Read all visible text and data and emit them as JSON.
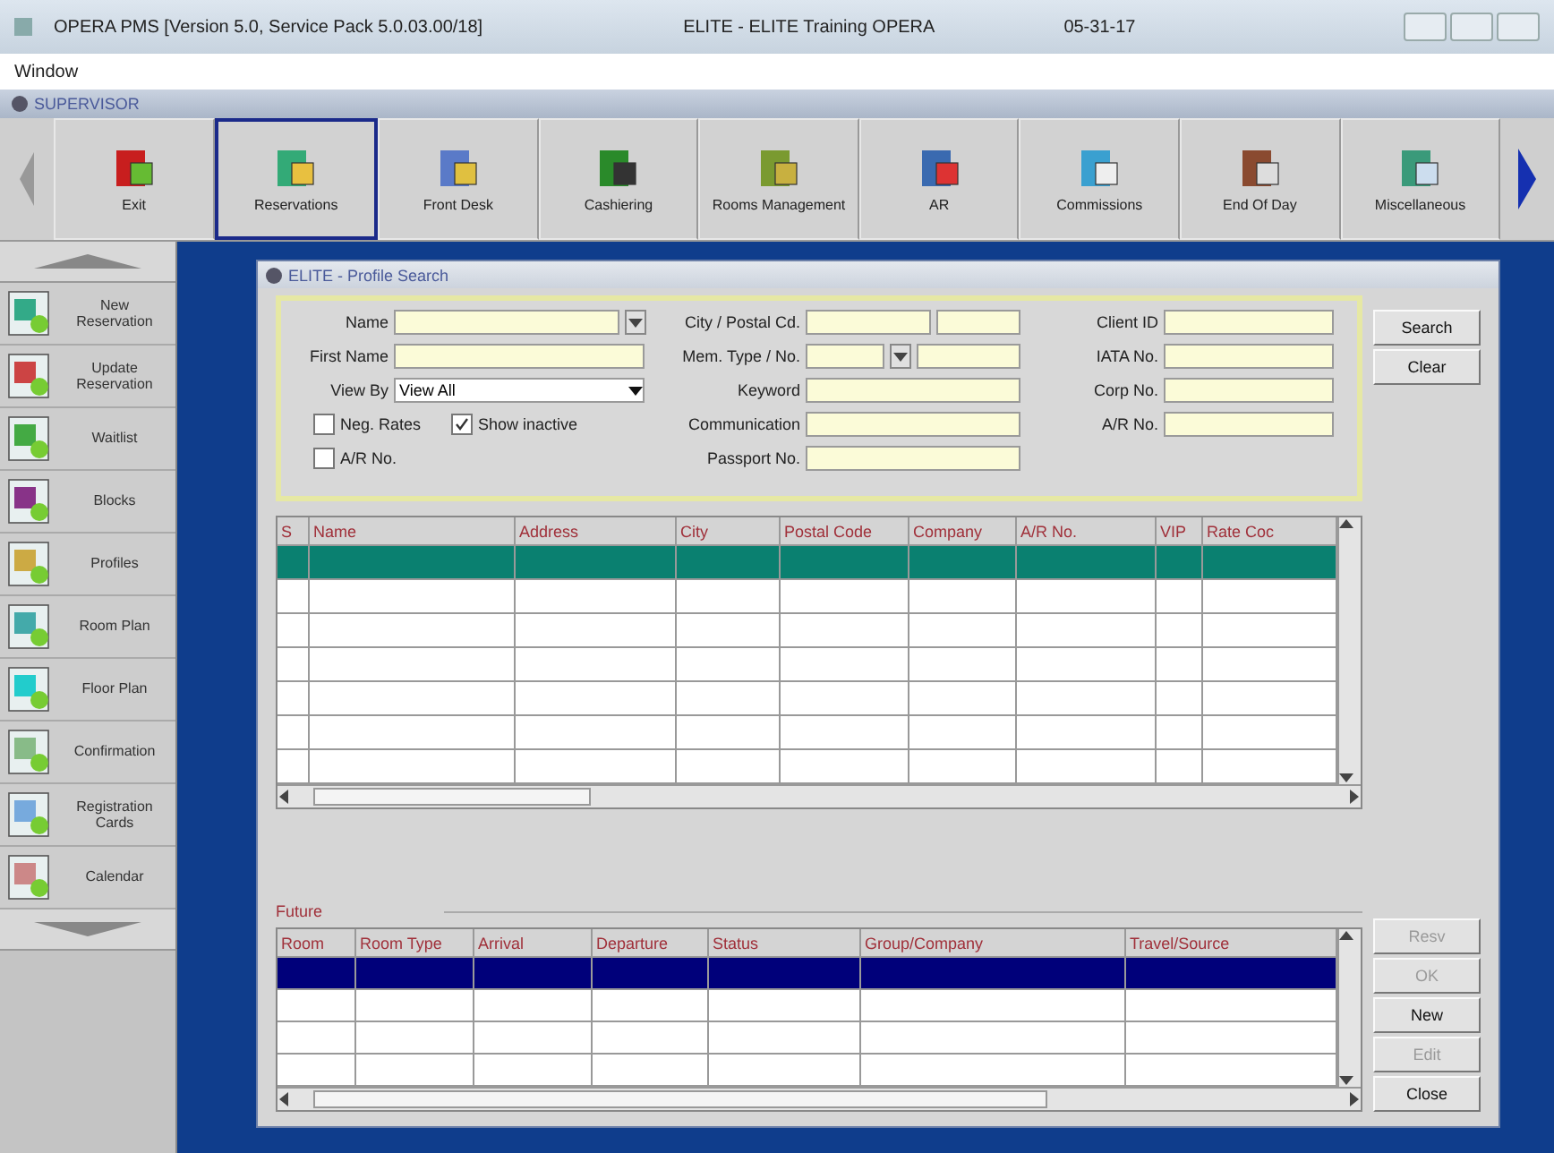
{
  "window": {
    "title": "OPERA PMS [Version 5.0, Service Pack 5.0.03.00/18]",
    "property": "ELITE - ELITE Training OPERA",
    "date": "05-31-17"
  },
  "menu": [
    "Window"
  ],
  "module": "SUPERVISOR",
  "toolbar": [
    {
      "label": "Exit",
      "selected": false
    },
    {
      "label": "Reservations",
      "selected": true
    },
    {
      "label": "Front Desk",
      "selected": false
    },
    {
      "label": "Cashiering",
      "selected": false
    },
    {
      "label": "Rooms Management",
      "selected": false
    },
    {
      "label": "AR",
      "selected": false
    },
    {
      "label": "Commissions",
      "selected": false
    },
    {
      "label": "End Of Day",
      "selected": false
    },
    {
      "label": "Miscellaneous",
      "selected": false
    }
  ],
  "sidebar": [
    {
      "label": "New Reservation"
    },
    {
      "label": "Update Reservation"
    },
    {
      "label": "Waitlist"
    },
    {
      "label": "Blocks"
    },
    {
      "label": "Profiles"
    },
    {
      "label": "Room Plan"
    },
    {
      "label": "Floor Plan"
    },
    {
      "label": "Confirmation"
    },
    {
      "label": "Registration Cards"
    },
    {
      "label": "Calendar"
    }
  ],
  "dialog": {
    "title": "ELITE - Profile Search",
    "form": [
      {
        "left": [
          {
            "kind": "lookup",
            "label": "Name"
          }
        ],
        "middle": [
          {
            "kind": "split",
            "label": "City / Postal Cd."
          }
        ],
        "right": [
          {
            "kind": "text",
            "label": "Client ID"
          }
        ]
      },
      {
        "left": [
          {
            "kind": "text",
            "label": "First Name"
          }
        ],
        "middle": [
          {
            "kind": "dropsplit",
            "label": "Mem. Type / No."
          }
        ],
        "right": [
          {
            "kind": "text",
            "label": "IATA No."
          }
        ]
      },
      {
        "left": [
          {
            "kind": "select",
            "label": "View By",
            "value": "View All"
          }
        ],
        "middle": [
          {
            "kind": "text",
            "label": "Keyword"
          }
        ],
        "right": [
          {
            "kind": "text",
            "label": "Corp No."
          }
        ]
      },
      {
        "left": [
          {
            "kind": "checkbox",
            "label": "Neg. Rates",
            "checked": false
          },
          {
            "kind": "checkbox",
            "label": "Show inactive",
            "checked": true
          }
        ],
        "middle": [
          {
            "kind": "text",
            "label": "Communication"
          }
        ],
        "right": [
          {
            "kind": "text",
            "label": "A/R No."
          }
        ]
      },
      {
        "left": [
          {
            "kind": "checkbox",
            "label": "A/R No.",
            "checked": false
          }
        ],
        "middle": [
          {
            "kind": "text",
            "label": "Passport No."
          }
        ]
      }
    ],
    "actions": [
      {
        "label": "Search",
        "disabled": false
      },
      {
        "label": "Clear",
        "disabled": false
      }
    ],
    "results": {
      "columns": [
        "S",
        "Name",
        "Address",
        "City",
        "Postal Code",
        "Company",
        "A/R No.",
        "VIP",
        "Rate Coc"
      ],
      "rows": [
        {
          "selected": true
        },
        {
          "selected": false
        },
        {
          "selected": false
        },
        {
          "selected": false
        },
        {
          "selected": false
        },
        {
          "selected": false
        },
        {
          "selected": false
        }
      ]
    },
    "future": {
      "title": "Future",
      "columns": [
        "Room",
        "Room Type",
        "Arrival",
        "Departure",
        "Status",
        "Group/Company",
        "Travel/Source"
      ],
      "rows": [
        {
          "selected": true
        },
        {
          "selected": false
        },
        {
          "selected": false
        },
        {
          "selected": false
        }
      ]
    },
    "buttons": [
      {
        "label": "Resv",
        "disabled": true
      },
      {
        "label": "OK",
        "disabled": true
      },
      {
        "label": "New",
        "disabled": false
      },
      {
        "label": "Edit",
        "disabled": true
      },
      {
        "label": "Close",
        "disabled": false
      }
    ]
  }
}
